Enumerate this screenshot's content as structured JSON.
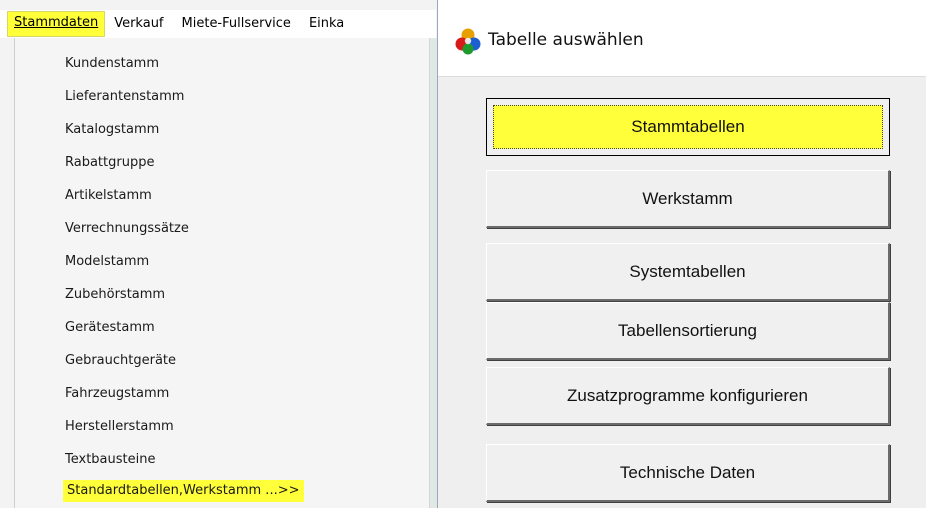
{
  "menubar": {
    "items": [
      {
        "label": "Stammdaten",
        "active": true
      },
      {
        "label": "Verkauf"
      },
      {
        "label": "Miete-Fullservice"
      },
      {
        "label": "Einka"
      }
    ]
  },
  "dropdown": {
    "items": [
      {
        "label": "Kundenstamm"
      },
      {
        "label": "Lieferantenstamm"
      },
      {
        "label": "Katalogstamm"
      },
      {
        "label": "Rabattgruppe"
      },
      {
        "label": "Artikelstamm"
      },
      {
        "label": "Verrechnungssätze"
      },
      {
        "label": "Modelstamm"
      },
      {
        "label": "Zubehörstamm"
      },
      {
        "label": "Gerätestamm"
      },
      {
        "label": "Gebrauchtgeräte"
      },
      {
        "label": "Fahrzeugstamm"
      },
      {
        "label": "Herstellerstamm"
      },
      {
        "label": "Textbausteine"
      },
      {
        "label": "Standardtabellen,Werkstamm ...>>",
        "highlighted": true
      }
    ]
  },
  "dialog": {
    "title": "Tabelle auswählen",
    "icon": "tricolor-orb-icon",
    "buttons": [
      {
        "label": "Stammtabellen",
        "focused": true
      },
      {
        "label": "Werkstamm"
      },
      {
        "label": "Systemtabellen"
      },
      {
        "label": "Tabellensortierung"
      },
      {
        "label": "Zusatzprogramme konfigurieren"
      },
      {
        "label": "Technische Daten"
      }
    ]
  },
  "colors": {
    "highlight": "#ffff3a",
    "menu_bg": "#f5f5f5",
    "dialog_bg": "#efefef"
  }
}
